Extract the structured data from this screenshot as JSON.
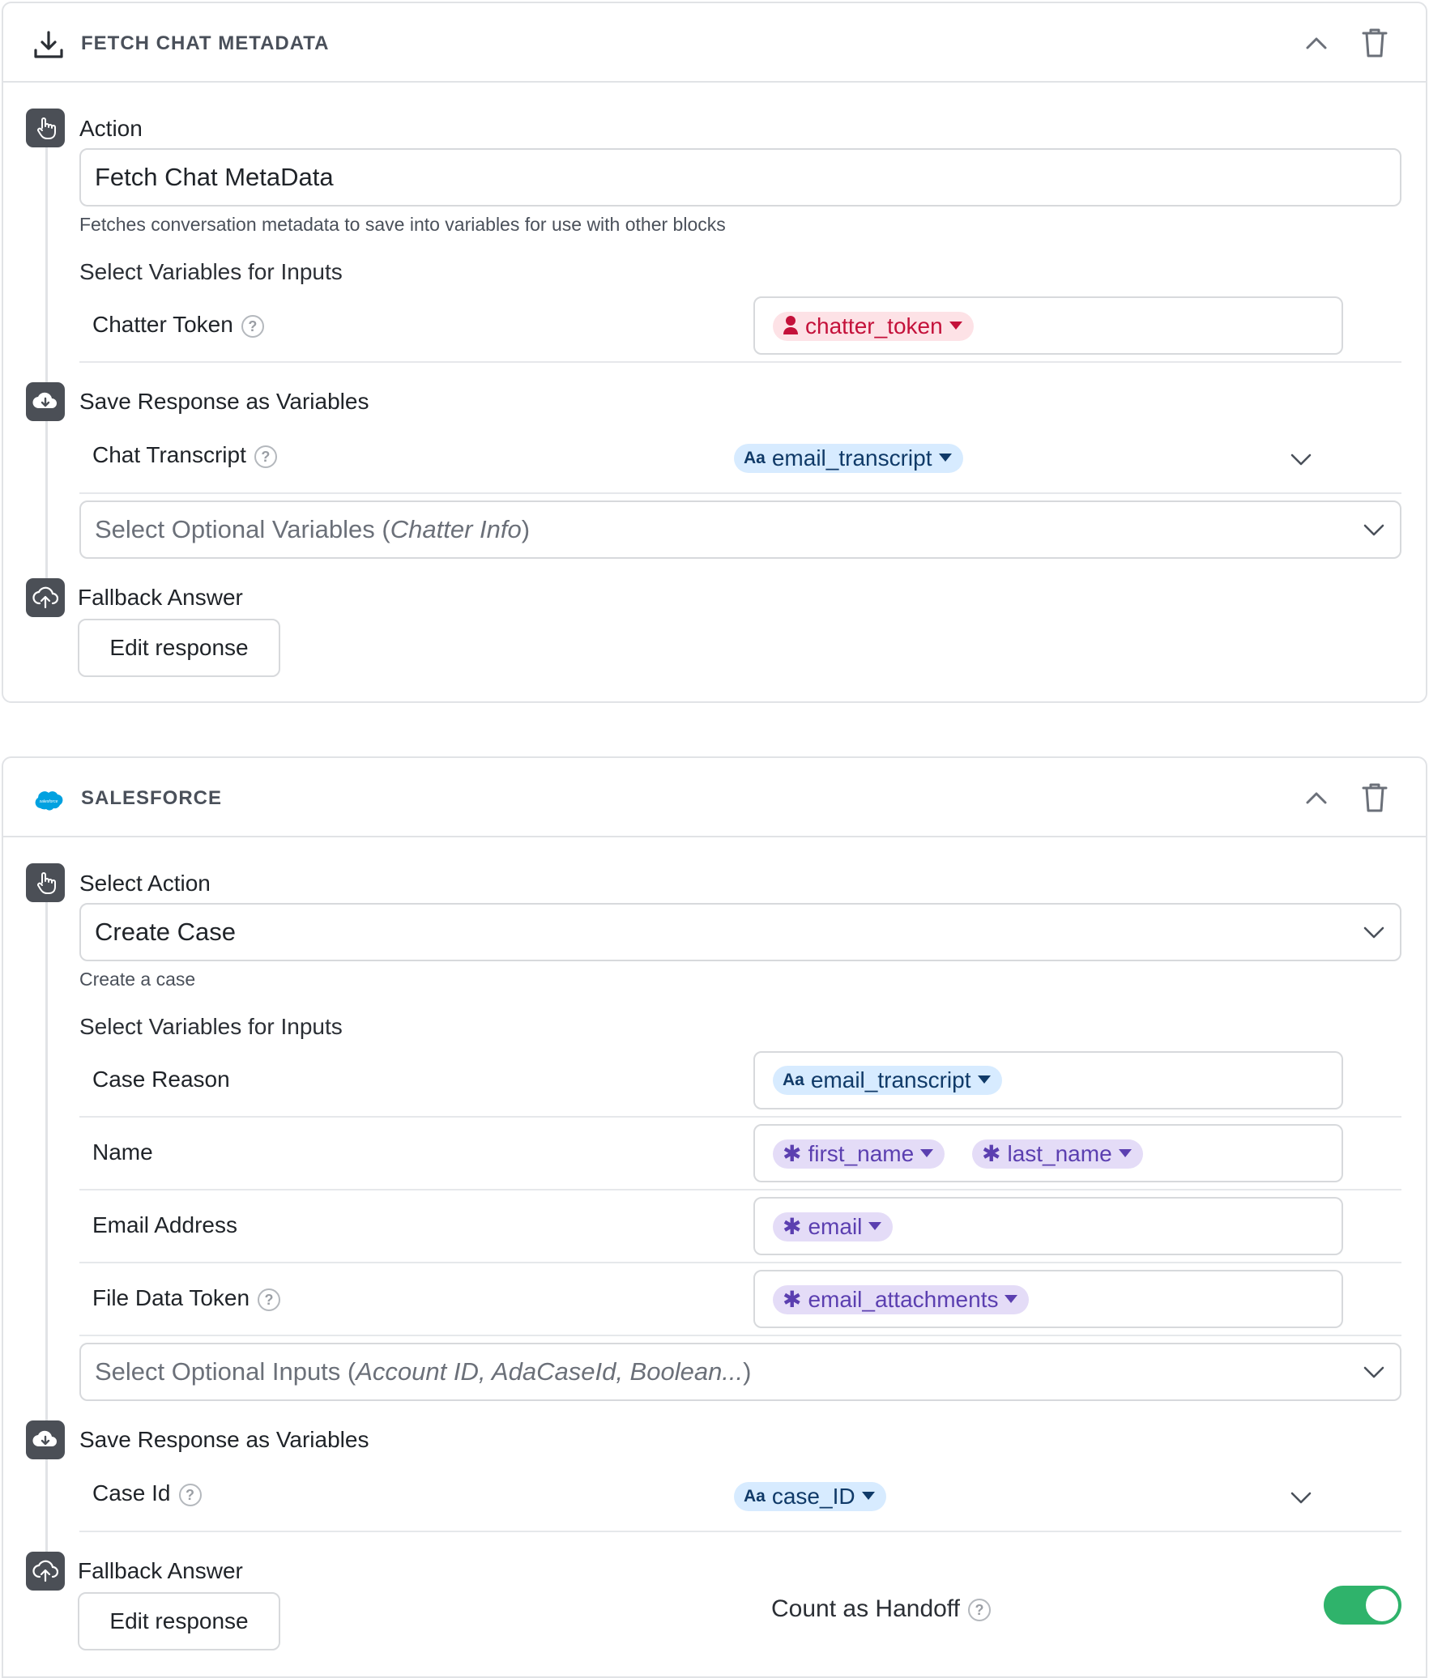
{
  "block1": {
    "title": "FETCH CHAT METADATA",
    "action_label": "Action",
    "action_value": "Fetch Chat MetaData",
    "action_helper": "Fetches conversation metadata to save into variables for use with other blocks",
    "inputs_heading": "Select Variables for Inputs",
    "input_row": {
      "label": "Chatter Token",
      "help": "?",
      "variable": "chatter_token",
      "variable_type": "person-icon"
    },
    "save_heading": "Save Response as Variables",
    "save_row": {
      "label": "Chat Transcript",
      "help": "?",
      "type_badge": "Aa",
      "variable": "email_transcript"
    },
    "optional_select": {
      "prefix": "Select Optional Variables (",
      "hint": "Chatter Info",
      "suffix": ")"
    },
    "fallback_label": "Fallback Answer",
    "edit_button": "Edit response"
  },
  "block2": {
    "title": "SALESFORCE",
    "action_label": "Select Action",
    "action_value": "Create Case",
    "action_helper": "Create a case",
    "inputs_heading": "Select Variables for Inputs",
    "rows": [
      {
        "label": "Case Reason",
        "type_badge": "Aa",
        "variables": [
          "email_transcript"
        ]
      },
      {
        "label": "Name",
        "variables": [
          "first_name",
          "last_name"
        ]
      },
      {
        "label": "Email Address",
        "variables": [
          "email"
        ]
      },
      {
        "label": "File Data Token",
        "help": "?",
        "variables": [
          "email_attachments"
        ]
      }
    ],
    "optional_select": {
      "prefix": "Select Optional Inputs (",
      "hint": "Account ID, AdaCaseId, Boolean...",
      "suffix": ")"
    },
    "save_heading": "Save Response as Variables",
    "save_row": {
      "label": "Case Id",
      "help": "?",
      "type_badge": "Aa",
      "variable": "case_ID"
    },
    "fallback_label": "Fallback Answer",
    "edit_button": "Edit response",
    "handoff_label": "Count as Handoff",
    "handoff_help": "?",
    "handoff_enabled": true
  },
  "colors": {
    "toggle_on": "#2fb36b",
    "salesforce_blue": "#00a1e0",
    "red_pill": "#c4113a",
    "blue_pill": "#103a68",
    "purple_pill": "#5b3fb0"
  }
}
